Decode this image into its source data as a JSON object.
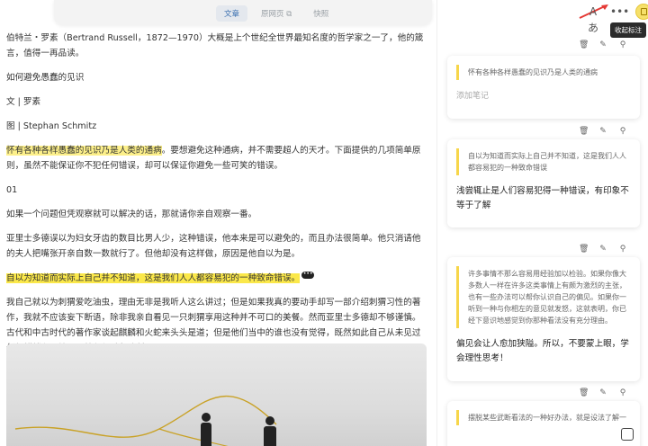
{
  "tabs": [
    {
      "label": "文章",
      "active": true
    },
    {
      "label": "原网页 ⧉",
      "active": false
    },
    {
      "label": "快照",
      "active": false
    }
  ],
  "toolbar": {
    "font_icon": "Aあ",
    "more_icon": "•••",
    "collect_tooltip": "收起标注"
  },
  "article": {
    "intro": "伯特兰・罗素（Bertrand Russell，1872—1970）大概是上个世纪全世界最知名度的哲学家之一了，他的箴言，值得一再品读。",
    "title": "如何避免愚蠢的见识",
    "author": "文 | 罗素",
    "illustrator": "图 | Stephan Schmitz",
    "p1_highlight": "怀有各种各样愚蠢的见识乃是人类的通病",
    "p1_rest": "。要想避免这种通病，并不需要超人的天才。下面提供的几项简单原则，虽然不能保证你不犯任何错误，却可以保证你避免一些可笑的错误。",
    "section": "01",
    "p2": "如果一个问题但凭观察就可以解决的话，那就请你亲自观察一番。",
    "p3": "亚里士多德误以为妇女牙齿的数目比男人少，这种错误，他本来是可以避免的，而且办法很简单。他只消请他的夫人把嘴张开亲自数一数就行了。但他却没有这样做，原因是他自以为是。",
    "p4_highlight": "自以为知道而实际上自己并不知道，这是我们人人都容易犯的一种致命错误。",
    "p5": "我自己就以为刺猬爱吃油虫，理由无非是我听人这么讲过；但是如果我真的要动手却写一部介绍刺猬习性的著作，我就不应该妄下断语，除非我亲自看见一只刺猬享用这种并不可口的美餐。然而亚里士多德却不够谨慎。古代和中古时代的著作家谈起麒麟和火蛇来头头是道；但是他们当中的谁也没有觉得，既然如此自己从未见过任何麒麟和火蛇，那就必须避免武断。"
  },
  "notes": [
    {
      "quote": "怀有各种各样愚蠢的见识乃是人类的通病",
      "note": "添加笔记",
      "is_placeholder": true
    },
    {
      "quote": "自以为知道而实际上自己并不知道，这是我们人人都容易犯的一种致命错误",
      "note": "浅尝辄止是人们容易犯得一种错误，有印象不等于了解",
      "is_placeholder": false
    },
    {
      "quote": "许多事情不那么容易用经验加以检验。如果你像大多数人一样在许多这类事情上有颇为激烈的主张，也有一些办法可以帮你认识自己的偏见。如果你一听到一种与你相左的意见就发怒，这就表明，你已经下意识地感觉到你那种看法没有充分理由。",
      "note": "偏见会让人愈加狭隘。所以，不要蒙上眼，学会理性思考！",
      "is_placeholder": false
    },
    {
      "quote": "摆脱某些武断看法的一种好办法，就是设法了解一",
      "note": "",
      "is_placeholder": false
    }
  ],
  "colors": {
    "highlight": "#fdf08a",
    "accent": "#f7d64a",
    "arrow": "#e53935"
  }
}
